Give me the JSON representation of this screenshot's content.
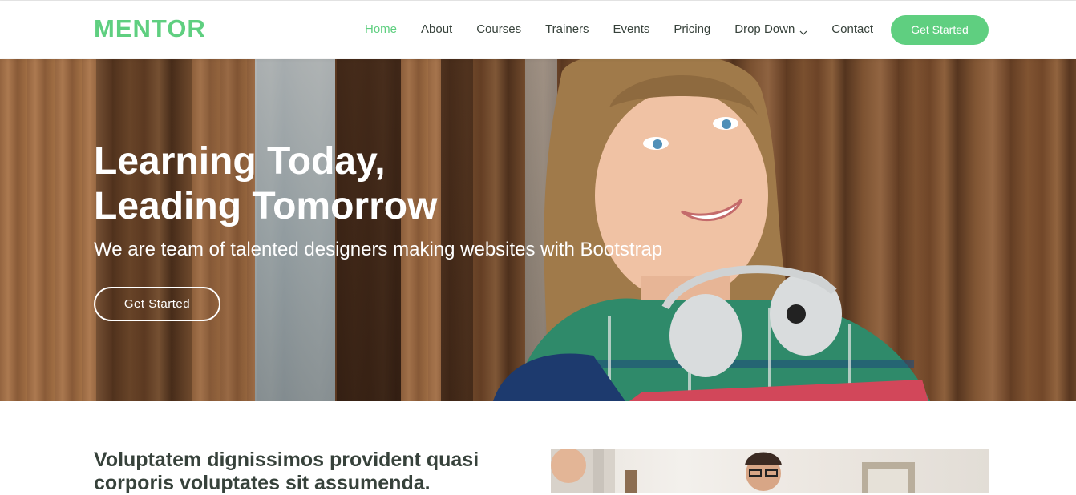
{
  "brand": {
    "logo": "MENTOR",
    "accent_color": "#5fcf80"
  },
  "nav": {
    "items": [
      {
        "label": "Home",
        "active": true
      },
      {
        "label": "About"
      },
      {
        "label": "Courses"
      },
      {
        "label": "Trainers"
      },
      {
        "label": "Events"
      },
      {
        "label": "Pricing"
      },
      {
        "label": "Drop Down",
        "icon": "chevron-down-icon"
      },
      {
        "label": "Contact"
      }
    ],
    "cta_label": "Get Started"
  },
  "hero": {
    "title_line1": "Learning Today,",
    "title_line2": "Leading Tomorrow",
    "subtitle": "We are team of talented designers making websites with Bootstrap",
    "cta_label": "Get Started"
  },
  "about": {
    "title": "Voluptatem dignissimos provident quasi corporis voluptates sit assumenda."
  }
}
